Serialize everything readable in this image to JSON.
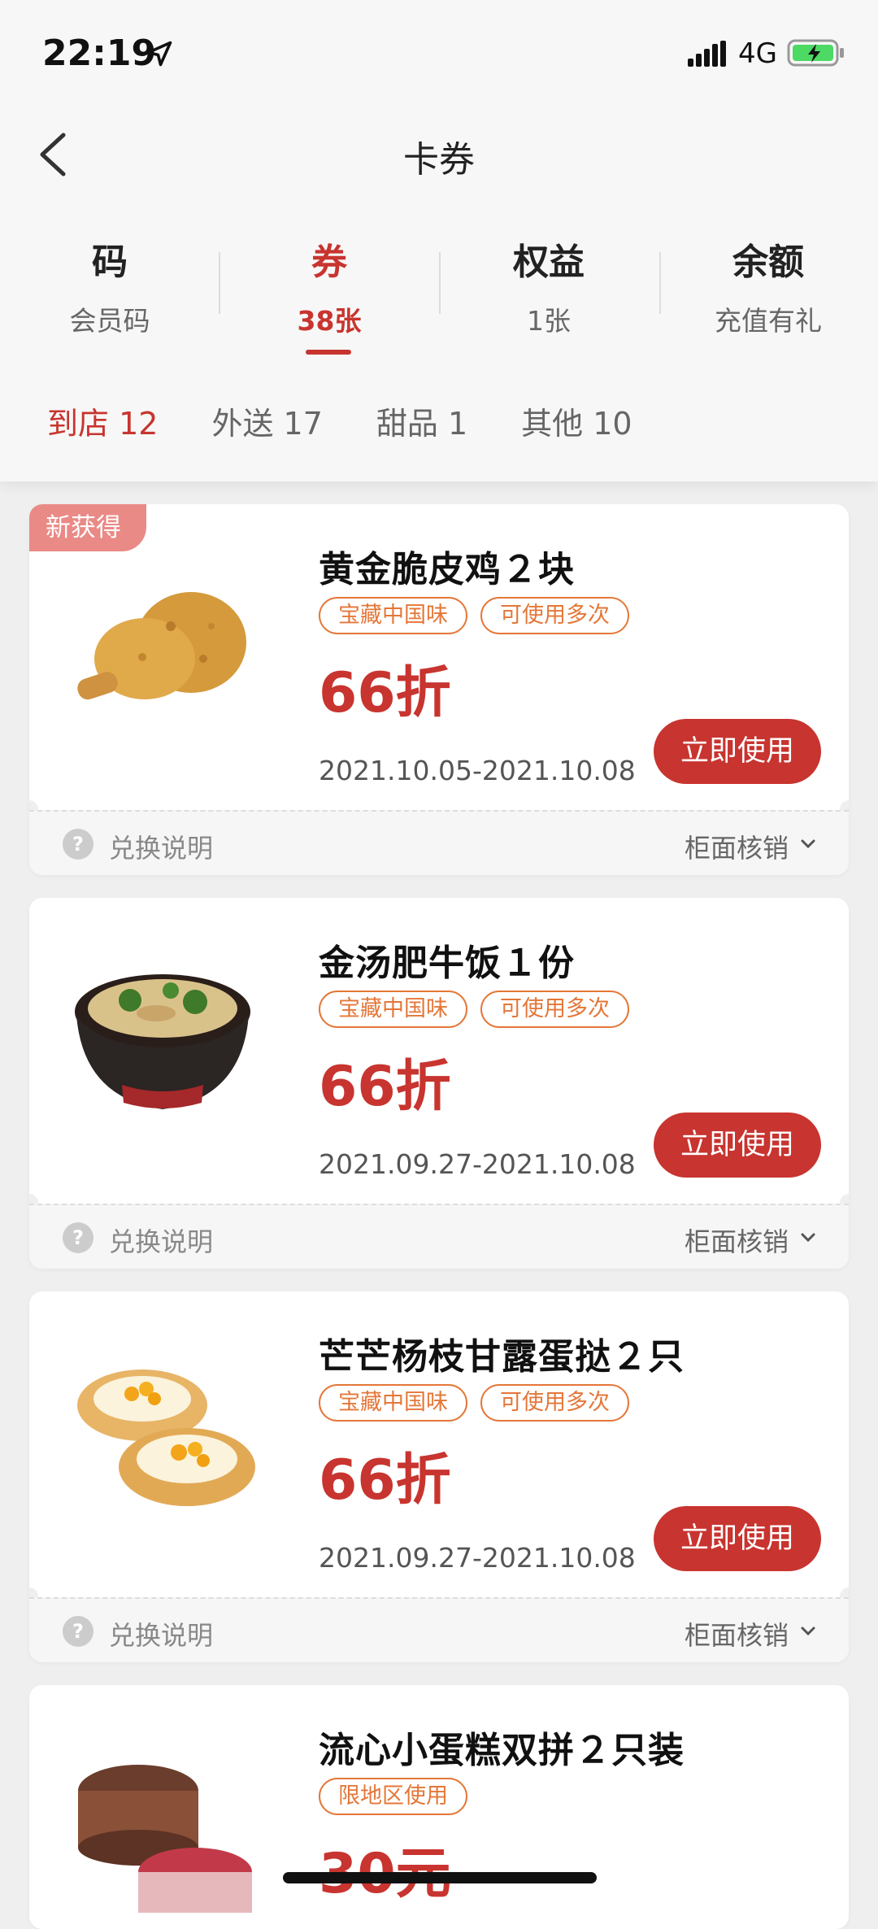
{
  "status": {
    "time": "22:19",
    "network": "4G"
  },
  "nav": {
    "title": "卡券"
  },
  "main_tabs": [
    {
      "label": "码",
      "sub": "会员码"
    },
    {
      "label": "券",
      "sub": "38张"
    },
    {
      "label": "权益",
      "sub": "1张"
    },
    {
      "label": "余额",
      "sub": "充值有礼"
    }
  ],
  "sub_tabs": [
    "到店 12",
    "外送 17",
    "甜品 1",
    "其他 10"
  ],
  "coupons": [
    {
      "badge": "新获得",
      "name": "黄金脆皮鸡２块",
      "tags": [
        "宝藏中国味",
        "可使用多次"
      ],
      "discount": "66折",
      "date": "2021.10.05-2021.10.08",
      "button": "立即使用",
      "rules": "兑换说明",
      "redeem": "柜面核销"
    },
    {
      "name": "金汤肥牛饭１份",
      "tags": [
        "宝藏中国味",
        "可使用多次"
      ],
      "discount": "66折",
      "date": "2021.09.27-2021.10.08",
      "button": "立即使用",
      "rules": "兑换说明",
      "redeem": "柜面核销"
    },
    {
      "name": "芒芒杨枝甘露蛋挞２只",
      "tags": [
        "宝藏中国味",
        "可使用多次"
      ],
      "discount": "66折",
      "date": "2021.09.27-2021.10.08",
      "button": "立即使用",
      "rules": "兑换说明",
      "redeem": "柜面核销"
    },
    {
      "name": "流心小蛋糕双拼２只装",
      "tags": [
        "限地区使用"
      ],
      "discount": "30元"
    }
  ],
  "colors": {
    "accent": "#c8342f",
    "tag": "#e47738"
  }
}
